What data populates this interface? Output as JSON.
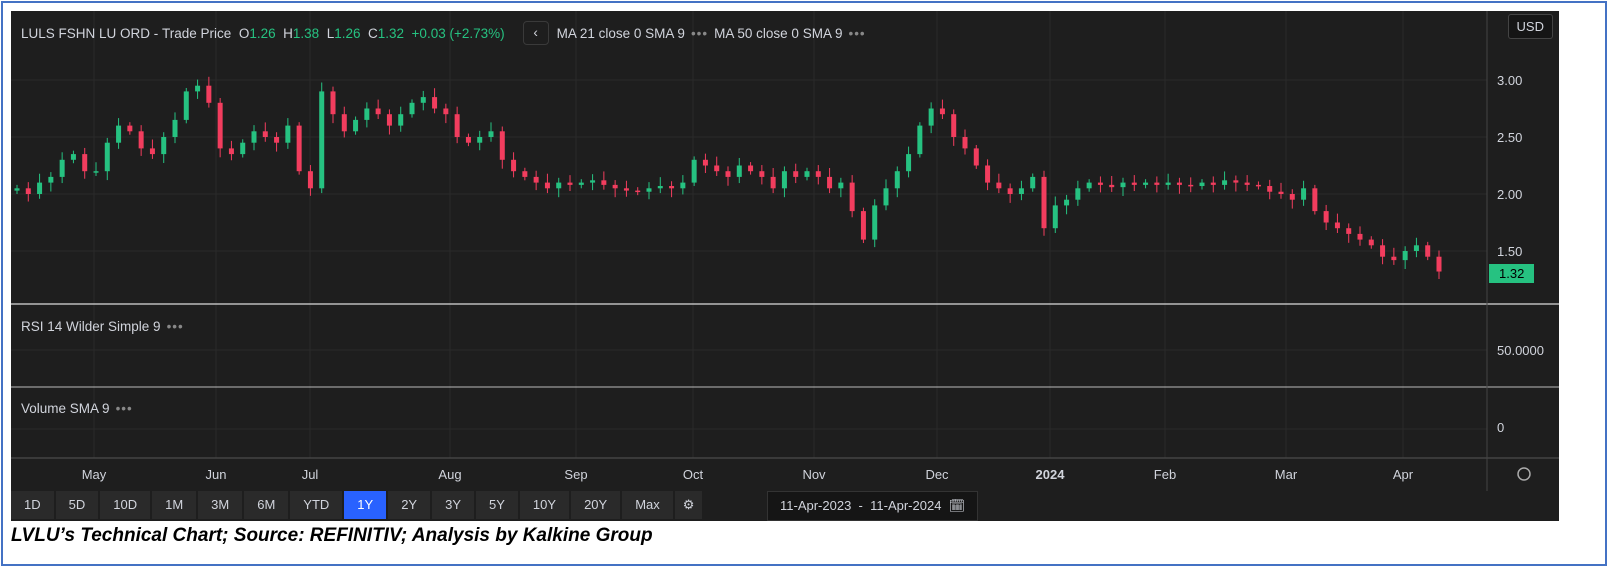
{
  "header": {
    "symbol": "LULS FSHN LU ORD",
    "source": "Trade Price",
    "o_label": "O",
    "o": "1.26",
    "h_label": "H",
    "h": "1.38",
    "l_label": "L",
    "l": "1.26",
    "c_label": "C",
    "c": "1.32",
    "change": "+0.03 (+2.73%)",
    "back_icon": "‹",
    "ma1": "MA 21 close 0 SMA 9",
    "ma2": "MA 50 close 0 SMA 9",
    "dots": "•••"
  },
  "currency": "USD",
  "rsi_label": "RSI 14 Wilder Simple 9",
  "rsi_axis": "50.0000",
  "volume_label": "Volume SMA 9",
  "volume_axis": "0",
  "last_price": "1.32",
  "colors": {
    "up": "#26c281",
    "down": "#f23d5e",
    "bg": "#1e1e1e",
    "active": "#2962ff"
  },
  "chart_data": {
    "type": "candlestick",
    "title": "LULS FSHN LU ORD - Trade Price",
    "y_ticks": [
      "3.00",
      "2.50",
      "2.00",
      "1.50"
    ],
    "ylim": [
      0.7,
      3.6
    ],
    "x_labels": [
      "May",
      "Jun",
      "Jul",
      "Aug",
      "Sep",
      "Oct",
      "Nov",
      "Dec",
      "2024",
      "Feb",
      "Mar",
      "Apr"
    ],
    "closes": [
      2.05,
      2.0,
      2.1,
      2.15,
      2.3,
      2.35,
      2.2,
      2.2,
      2.45,
      2.6,
      2.55,
      2.4,
      2.35,
      2.5,
      2.65,
      2.9,
      2.95,
      2.8,
      2.4,
      2.35,
      2.45,
      2.55,
      2.5,
      2.45,
      2.6,
      2.2,
      2.05,
      2.9,
      2.7,
      2.55,
      2.65,
      2.75,
      2.7,
      2.6,
      2.7,
      2.8,
      2.85,
      2.75,
      2.7,
      2.5,
      2.45,
      2.5,
      2.55,
      2.3,
      2.2,
      2.15,
      2.1,
      2.05,
      2.1,
      2.08,
      2.1,
      2.12,
      2.08,
      2.05,
      2.03,
      2.02,
      2.05,
      2.07,
      2.05,
      2.1,
      2.3,
      2.25,
      2.2,
      2.15,
      2.25,
      2.2,
      2.15,
      2.05,
      2.2,
      2.15,
      2.2,
      2.15,
      2.05,
      2.1,
      1.85,
      1.6,
      1.9,
      2.05,
      2.2,
      2.35,
      2.6,
      2.75,
      2.7,
      2.5,
      2.4,
      2.25,
      2.1,
      2.05,
      2.0,
      2.05,
      2.15,
      1.7,
      1.9,
      1.95,
      2.05,
      2.1,
      2.08,
      2.06,
      2.1,
      2.08,
      2.1,
      2.08,
      2.1,
      2.08,
      2.07,
      2.1,
      2.08,
      2.12,
      2.1,
      2.08,
      2.07,
      2.02,
      2.0,
      1.95,
      2.05,
      1.85,
      1.75,
      1.7,
      1.65,
      1.6,
      1.55,
      1.45,
      1.42,
      1.5,
      1.55,
      1.45,
      1.32
    ]
  },
  "toolbar": {
    "ranges": [
      "1D",
      "5D",
      "10D",
      "1M",
      "3M",
      "6M",
      "YTD",
      "1Y",
      "2Y",
      "3Y",
      "5Y",
      "10Y",
      "20Y",
      "Max"
    ],
    "active": "1Y",
    "settings_icon": "⚙"
  },
  "date_range": {
    "from": "11-Apr-2023",
    "sep": "-",
    "to": "11-Apr-2024",
    "calendar_icon": "🗓"
  },
  "caption": "LVLU’s Technical Chart; Source: REFINITIV; Analysis by Kalkine Group"
}
